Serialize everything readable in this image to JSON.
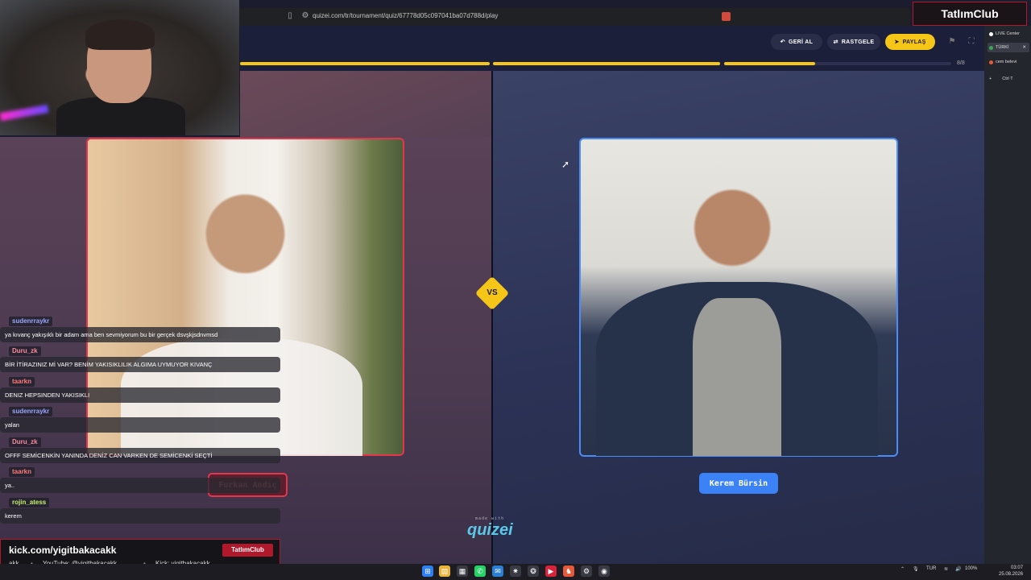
{
  "browser": {
    "url": "quizei.com/tr/tournament/quiz/67778d05c097041ba07d788d/play"
  },
  "header": {
    "back_label": "GERİ AL",
    "random_label": "RASTGELE",
    "share_label": "PAYLAŞ",
    "round": "8/8",
    "progress": [
      1.0,
      1.0,
      0.4
    ]
  },
  "quiz": {
    "left_name": "Furkan Andıç",
    "right_name": "Kerem Bürsin",
    "vs_label": "VS",
    "brand_small": "made with",
    "brand": "quizei"
  },
  "chat": [
    {
      "user": "sudenrraykr",
      "color": "#9aa7ff",
      "message": "ya kıvanç yakışıklı bir adam ama ben sevmiyorum bu bir gerçek dsvşkjsdnvmsd"
    },
    {
      "user": "Duru_zk",
      "color": "#ff8aa0",
      "message": "BİR İTİRAZINIZ Mİ VAR? BENİM YAKISIKLILIK ALGIMA UYMUYOR KIVANÇ"
    },
    {
      "user": "taarkn",
      "color": "#ff7a7a",
      "message": "DENIZ HEPSINDEN YAKISIKLI"
    },
    {
      "user": "sudenrraykr",
      "color": "#9aa7ff",
      "message": "yalan"
    },
    {
      "user": "Duru_zk",
      "color": "#ff8aa0",
      "message": "OFFF SEMİCENKİN YANINDA DENİZ CAN VARKEN DE SEMİCENKİ SEÇTİ"
    },
    {
      "user": "taarkn",
      "color": "#ff7a7a",
      "message": "ya.."
    },
    {
      "user": "rojin_atess",
      "color": "#c9f26b",
      "message": "kerem"
    }
  ],
  "stream": {
    "kick_url": "kick.com/yigitbakacakk",
    "club": "TatlımClub",
    "ticker_1": "akk",
    "ticker_2": "YouTube: @yigitbakacakk",
    "ticker_3": "Kick: yigitbakacakk"
  },
  "top_badge": "TatlımClub",
  "side_panel": {
    "items": [
      "LIVE Center",
      "TÜRKİ",
      "cem belevi",
      "Ctrl  T"
    ]
  },
  "taskbar": {
    "lang": "TUR",
    "battery": "100%",
    "time": "03:07",
    "date": "25.08.2026"
  },
  "colors": {
    "accent_yellow": "#f5c518",
    "left_red": "#e3364b",
    "right_blue": "#3b82f6",
    "stream_red": "#b1182c"
  }
}
